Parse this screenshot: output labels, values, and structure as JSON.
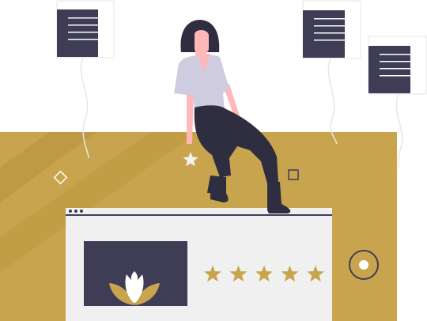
{
  "illustration": {
    "subject": "woman-sitting-on-browser-window",
    "rating": {
      "value": 5,
      "max": 5
    },
    "colors": {
      "accent": "#C9A44E",
      "accent_dark": "#B8953E",
      "dark": "#3F3D56",
      "window_bg": "#F0F0F0",
      "shirt": "#CFCCE0",
      "pants": "#2F2E41",
      "skin": "#FFB8B8",
      "star_white": "#F2F2F2"
    },
    "icons": [
      "document-icon",
      "flower-icon",
      "star-icon",
      "diamond-icon",
      "square-icon",
      "circle-target-icon"
    ]
  }
}
